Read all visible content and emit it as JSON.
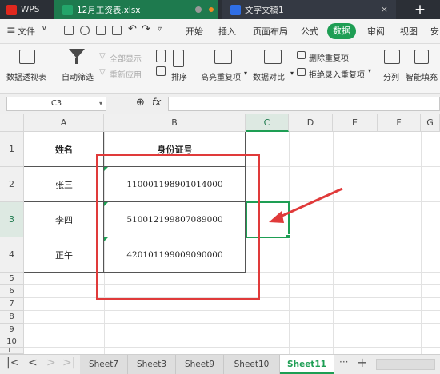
{
  "titlebar": {
    "wps_label": "WPS",
    "xlsx_tab": "12月工资表.xlsx",
    "doc_tab": "文字文稿1",
    "close_glyph": "×",
    "plus_glyph": "+"
  },
  "menu": {
    "file": "文件",
    "items": [
      "开始",
      "插入",
      "页面布局",
      "公式",
      "数据",
      "审阅",
      "视图",
      "安"
    ]
  },
  "ribbon": {
    "pivot": "数据透视表",
    "autofilter": "自动筛选",
    "show_all": "全部显示",
    "reapply": "重新应用",
    "sort": "排序",
    "highlight_dup": "高亮重复项",
    "compare": "数据对比",
    "delete_dup": "删除重复项",
    "reject_dup": "拒绝录入重复项",
    "split": "分列",
    "smart_fill": "智能填充"
  },
  "formula_bar": {
    "name_box": "C3",
    "fx": "fx",
    "formula": ""
  },
  "grid": {
    "columns": [
      "A",
      "B",
      "C",
      "D",
      "E",
      "F",
      "G"
    ],
    "rows": [
      "1",
      "2",
      "3",
      "4",
      "5",
      "6",
      "7",
      "8",
      "9",
      "10",
      "11"
    ],
    "header_name": "姓名",
    "header_id": "身份证号",
    "people": [
      {
        "name": "张三",
        "id": "110001198901014000"
      },
      {
        "name": "李四",
        "id": "510012199807089000"
      },
      {
        "name": "正午",
        "id": "420101199009090000"
      }
    ]
  },
  "sheets": {
    "tabs": [
      "Sheet7",
      "Sheet3",
      "Sheet9",
      "Sheet10",
      "Sheet11"
    ],
    "active": "Sheet11",
    "more": "···",
    "add": "+"
  },
  "colors": {
    "accent": "#1e9e54",
    "annotation": "#e03a3a",
    "title_bg": "#2b2f36"
  }
}
